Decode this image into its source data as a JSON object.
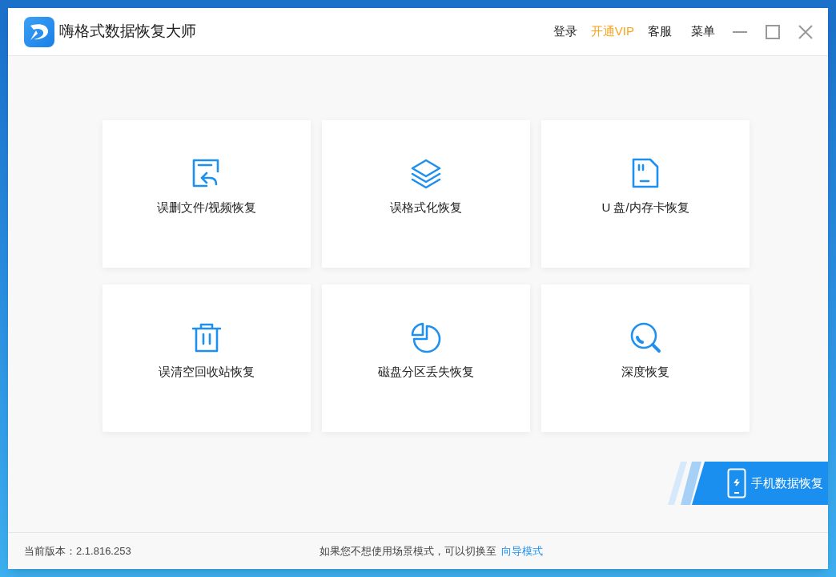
{
  "window": {
    "title": "嗨格式数据恢复大师"
  },
  "nav": [
    {
      "label": "登录",
      "kind": "normal"
    },
    {
      "label": "开通VIP",
      "kind": "vip"
    },
    {
      "label": "客服",
      "kind": "normal"
    },
    {
      "label": "菜单",
      "kind": "normal"
    }
  ],
  "cards": [
    {
      "label": "误删文件/视频恢复",
      "kind": "file"
    },
    {
      "label": "误格式化恢复",
      "kind": "layers"
    },
    {
      "label": "U 盘/内存卡恢复",
      "kind": "sdcard"
    },
    {
      "label": "误清空回收站恢复",
      "kind": "trash"
    },
    {
      "label": "磁盘分区丢失恢复",
      "kind": "pie"
    },
    {
      "label": "深度恢复",
      "kind": "search"
    }
  ],
  "mobile_button": {
    "label": "手机数据恢复"
  },
  "footer": {
    "version": "当前版本：2.1.816.253",
    "hint": "如果您不想使用场景模式，可以切换至",
    "link": "向导模式"
  }
}
